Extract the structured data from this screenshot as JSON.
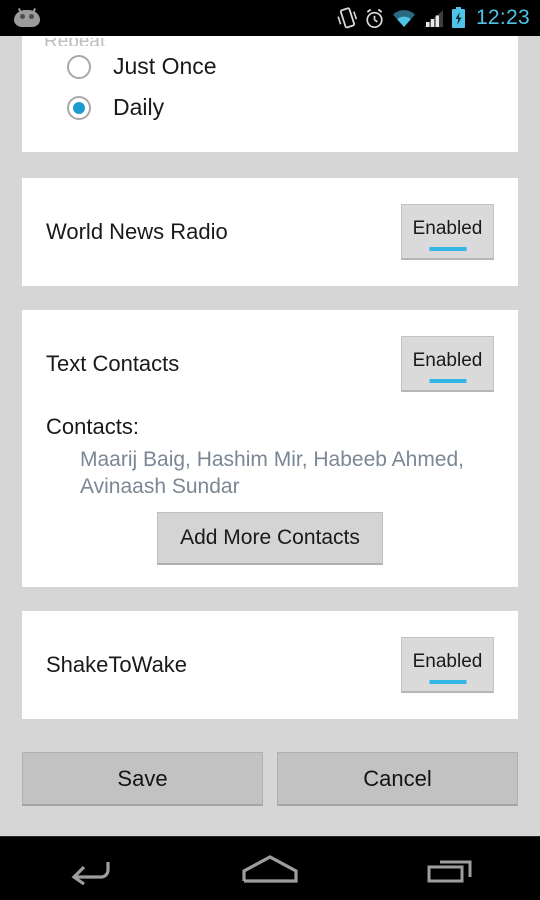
{
  "status_bar": {
    "logo_icon": "cyanogenmod-cid-icon",
    "icons": [
      "vibrate-icon",
      "alarm-icon",
      "wifi-icon",
      "cellular-signal-icon",
      "battery-charging-icon"
    ],
    "time": "12:23",
    "time_color": "#4fc3e8"
  },
  "repeat_card": {
    "cut_off_title": "Repeat",
    "options": [
      {
        "label": "Just Once",
        "selected": false
      },
      {
        "label": "Daily",
        "selected": true
      }
    ],
    "accent_color": "#1b9bd0"
  },
  "radio_card": {
    "world_news": {
      "title": "World News Radio",
      "toggle_label": "Enabled",
      "toggle_state": "enabled"
    }
  },
  "text_contacts_card": {
    "title": "Text Contacts",
    "toggle_label": "Enabled",
    "contacts_label": "Contacts:",
    "contacts_value": "Maarij Baig, Hashim Mir, Habeeb Ahmed, Avinaash Sundar",
    "contacts_color": "#7b8794",
    "add_button_label": "Add More Contacts"
  },
  "shake_card": {
    "title": "ShakeToWake",
    "toggle_label": "Enabled"
  },
  "actions": {
    "save_label": "Save",
    "cancel_label": "Cancel"
  },
  "nav_bar": {
    "back_icon": "back-arrow-icon",
    "home_icon": "home-icon",
    "recents_icon": "recent-apps-icon"
  },
  "theme": {
    "page_background": "#d6d6d6",
    "card_background": "#ffffff",
    "accent_blue": "#33b5e5",
    "text_primary": "#1a1a1a"
  }
}
